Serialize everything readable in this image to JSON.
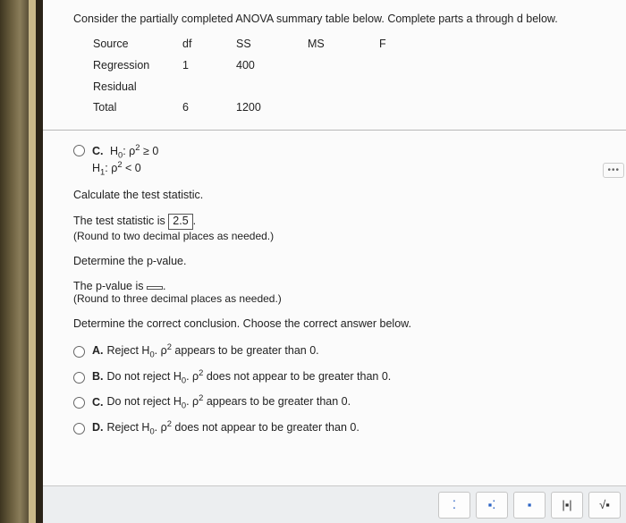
{
  "intro": "Consider the partially completed ANOVA summary table below. Complete parts a through d below.",
  "anova": {
    "headers": {
      "source": "Source",
      "df": "df",
      "ss": "SS",
      "ms": "MS",
      "f": "F"
    },
    "rows": [
      {
        "source": "Regression",
        "df": "1",
        "ss": "400",
        "ms": "",
        "f": ""
      },
      {
        "source": "Residual",
        "df": "",
        "ss": "",
        "ms": "",
        "f": ""
      },
      {
        "source": "Total",
        "df": "6",
        "ss": "1200",
        "ms": "",
        "f": ""
      }
    ]
  },
  "optionC": {
    "label": "C.",
    "h0_prefix": "H",
    "h0_sub": "0",
    "h0_rest": ": ρ",
    "h0_sup": "2",
    "h0_tail": " ≥ 0",
    "h1_prefix": "H",
    "h1_sub": "1",
    "h1_rest": ": ρ",
    "h1_sup": "2",
    "h1_tail": " < 0"
  },
  "calc_label": "Calculate the test statistic.",
  "stat_line_prefix": "The test statistic is ",
  "stat_value": "2.5",
  "stat_line_suffix": ".",
  "round2_note": "(Round to two decimal places as needed.)",
  "determine_p": "Determine the p-value.",
  "p_line_prefix": "The p-value is ",
  "p_value": "",
  "p_line_suffix": ".",
  "round3_note": "(Round to three decimal places as needed.)",
  "determine_conc": "Determine the correct conclusion. Choose the correct answer below.",
  "conc": {
    "a": {
      "label": "A.",
      "pre": "Reject H",
      "sub": "0",
      "mid": ". ρ",
      "sup": "2",
      "tail": " appears to be greater than 0."
    },
    "b": {
      "label": "B.",
      "pre": "Do not reject H",
      "sub": "0",
      "mid": ". ρ",
      "sup": "2",
      "tail": " does not appear to be greater than 0."
    },
    "c": {
      "label": "C.",
      "pre": "Do not reject H",
      "sub": "0",
      "mid": ". ρ",
      "sup": "2",
      "tail": " appears to be greater than 0."
    },
    "d": {
      "label": "D.",
      "pre": "Reject H",
      "sub": "0",
      "mid": ". ρ",
      "sup": "2",
      "tail": " does not appear to be greater than 0."
    }
  },
  "dots": "•••",
  "toolbar": {
    "frac": "⁚",
    "mixed": "▪⁚",
    "dot": "▪",
    "bars": "|▪|",
    "root": "√▪"
  }
}
